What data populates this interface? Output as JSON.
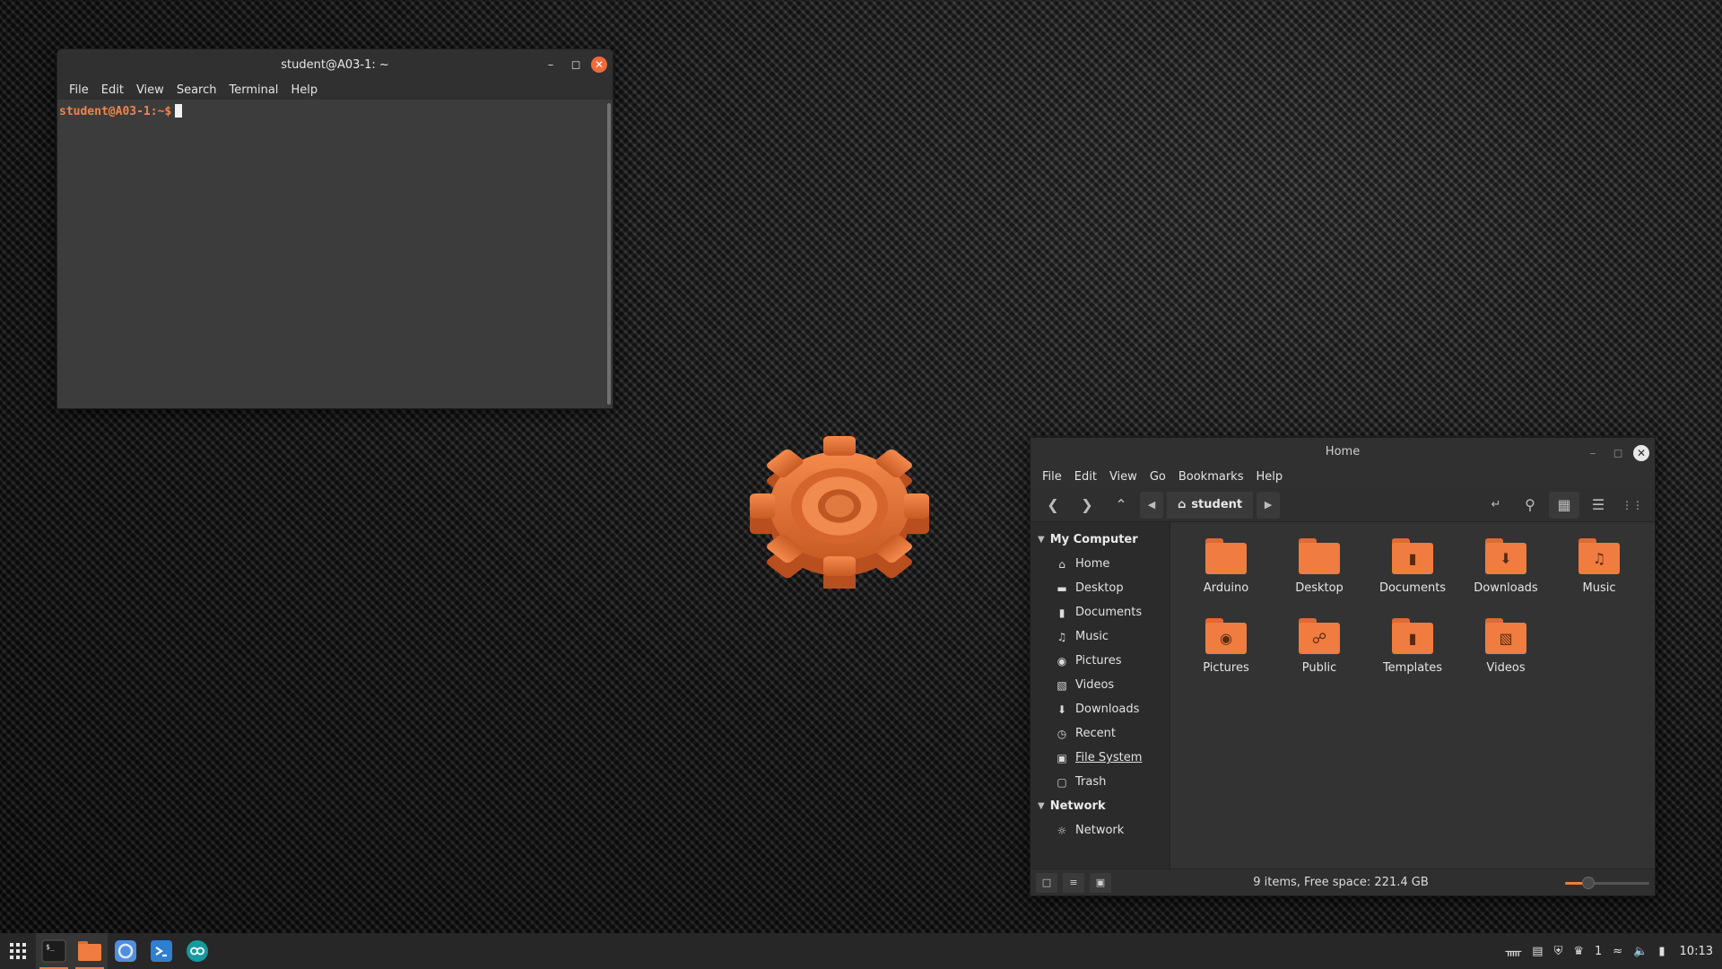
{
  "terminal": {
    "title": "student@A03-1: ~",
    "menu": [
      "File",
      "Edit",
      "View",
      "Search",
      "Terminal",
      "Help"
    ],
    "prompt": "student@A03-1:~$"
  },
  "file_manager": {
    "title": "Home",
    "menu": [
      "File",
      "Edit",
      "View",
      "Go",
      "Bookmarks",
      "Help"
    ],
    "location": "student",
    "sidebar": {
      "my_computer": {
        "heading": "My Computer",
        "items": [
          {
            "label": "Home",
            "icon": "home-icon"
          },
          {
            "label": "Desktop",
            "icon": "desktop-icon"
          },
          {
            "label": "Documents",
            "icon": "document-icon"
          },
          {
            "label": "Music",
            "icon": "music-icon"
          },
          {
            "label": "Pictures",
            "icon": "camera-icon"
          },
          {
            "label": "Videos",
            "icon": "film-icon"
          },
          {
            "label": "Downloads",
            "icon": "download-icon"
          },
          {
            "label": "Recent",
            "icon": "clock-icon"
          },
          {
            "label": "File System",
            "icon": "drive-icon"
          },
          {
            "label": "Trash",
            "icon": "trash-icon"
          }
        ]
      },
      "network": {
        "heading": "Network",
        "items": [
          {
            "label": "Network",
            "icon": "globe-icon"
          }
        ]
      }
    },
    "folders": [
      {
        "name": "Arduino",
        "emblem": ""
      },
      {
        "name": "Desktop",
        "emblem": ""
      },
      {
        "name": "Documents",
        "emblem": "document-icon"
      },
      {
        "name": "Downloads",
        "emblem": "download-icon"
      },
      {
        "name": "Music",
        "emblem": "music-icon"
      },
      {
        "name": "Pictures",
        "emblem": "camera-icon"
      },
      {
        "name": "Public",
        "emblem": "share-icon"
      },
      {
        "name": "Templates",
        "emblem": "document-icon"
      },
      {
        "name": "Videos",
        "emblem": "film-icon"
      }
    ],
    "status": "9 items, Free space: 221.4 GB",
    "zoom_level": 0.2
  },
  "taskbar": {
    "apps": [
      "terminal",
      "files",
      "browser",
      "vscode",
      "arduino"
    ],
    "workspace_number": "1",
    "clock": "10:13"
  },
  "colors": {
    "accent": "#f07c40",
    "close_button": "#f06a3a"
  }
}
